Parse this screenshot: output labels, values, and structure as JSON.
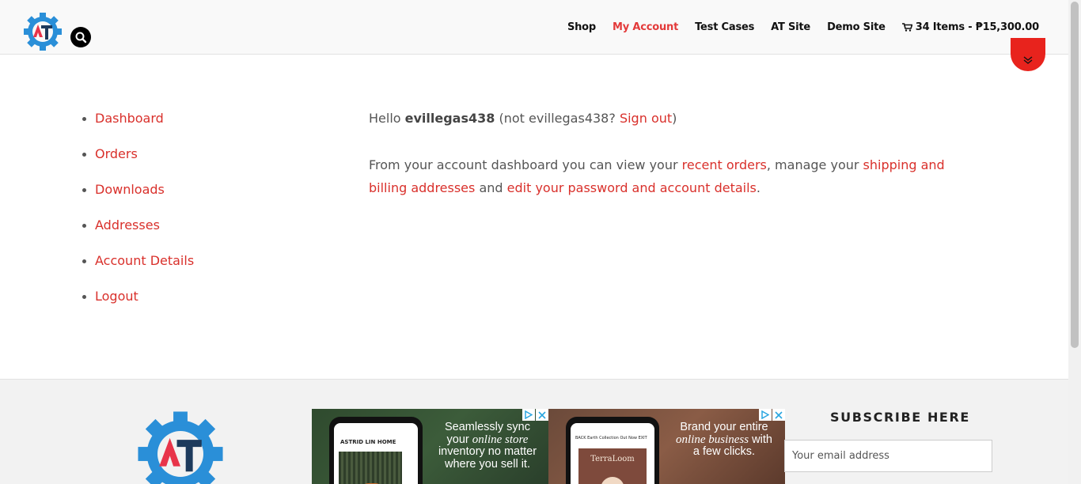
{
  "header": {
    "nav": [
      {
        "label": "Shop",
        "active": false
      },
      {
        "label": "My Account",
        "active": true
      },
      {
        "label": "Test Cases",
        "active": false
      },
      {
        "label": "AT Site",
        "active": false
      },
      {
        "label": "Demo Site",
        "active": false
      }
    ],
    "cart_label": "34 Items - ₱15,300.00",
    "icons": {
      "search": "search-icon",
      "cart": "cart-icon",
      "logo": "at-gear-logo",
      "scroll": "double-chevron-down-icon"
    }
  },
  "account_nav": {
    "items": [
      "Dashboard",
      "Orders",
      "Downloads",
      "Addresses",
      "Account Details",
      "Logout"
    ]
  },
  "dashboard": {
    "hello_prefix": "Hello ",
    "username": "evillegas438",
    "not_prefix": " (not ",
    "not_user": "evillegas438?",
    "sign_out": "Sign out",
    "close_paren": ")",
    "intro_1": "From your account dashboard you can view your ",
    "link_recent_orders": "recent orders",
    "intro_2": ", manage your ",
    "link_addresses": "shipping and billing addresses",
    "intro_3": " and ",
    "link_account": "edit your password and account details",
    "intro_4": "."
  },
  "footer": {
    "ads": [
      {
        "screen_title": "ASTRID LIN HOME",
        "line1": "Seamlessly sync",
        "line2_plain": "your ",
        "line2_italic": "online store",
        "line3": "inventory no matter",
        "line4": "where you sell it."
      },
      {
        "screen_top": "BACK    Earth Collection Out Now    EXIT",
        "screen_brand": "TerraLoom",
        "line1": "Brand your entire",
        "line2_italic": "online business",
        "line2_plain": " with",
        "line3": "a few clicks."
      }
    ],
    "subscribe_title": "SUBSCRIBE HERE",
    "email_placeholder": "Your email address"
  },
  "colors": {
    "accent": "#d9302b",
    "active_nav": "#e33a3a",
    "scroll_circle": "#e8231d",
    "logo_blue": "#2a8fd8",
    "logo_navy": "#1d3a5c"
  }
}
